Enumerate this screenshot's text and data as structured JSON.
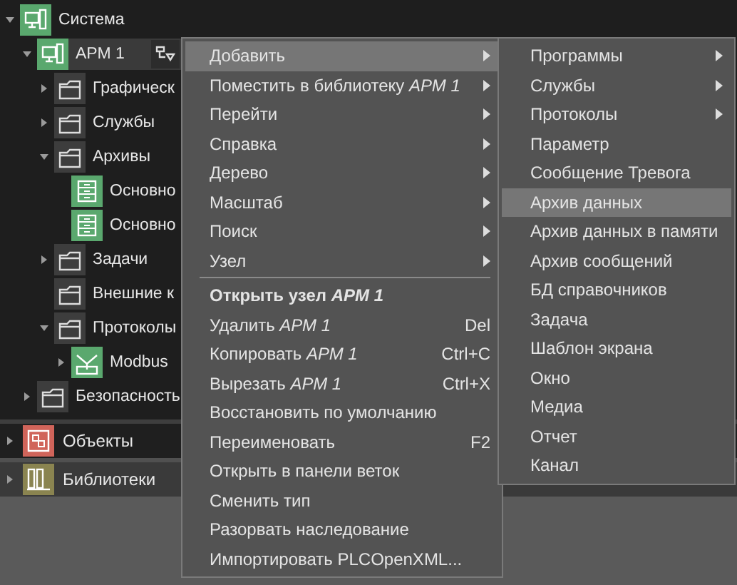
{
  "tree": [
    {
      "label": "Система",
      "kind": "system",
      "expanded": true,
      "has_children": true,
      "selected": false,
      "children": [
        {
          "label": "АРМ 1",
          "kind": "workstation",
          "expanded": true,
          "has_children": true,
          "selected": true,
          "filter_button": true,
          "children": [
            {
              "label": "Графическ",
              "kind": "folder",
              "expanded": false,
              "has_children": true,
              "selected": false
            },
            {
              "label": "Службы",
              "kind": "folder",
              "expanded": false,
              "has_children": true,
              "selected": false
            },
            {
              "label": "Архивы",
              "kind": "folder",
              "expanded": true,
              "has_children": true,
              "selected": false,
              "children": [
                {
                  "label": "Основно",
                  "kind": "archive",
                  "expanded": false,
                  "has_children": false,
                  "selected": false
                },
                {
                  "label": "Основно",
                  "kind": "archive",
                  "expanded": false,
                  "has_children": false,
                  "selected": false
                }
              ]
            },
            {
              "label": "Задачи",
              "kind": "folder",
              "expanded": false,
              "has_children": true,
              "selected": false
            },
            {
              "label": "Внешние к",
              "kind": "folder",
              "expanded": false,
              "has_children": false,
              "selected": false
            },
            {
              "label": "Протоколы",
              "kind": "folder",
              "expanded": true,
              "has_children": true,
              "selected": false,
              "children": [
                {
                  "label": "Modbus",
                  "kind": "modbus",
                  "expanded": false,
                  "has_children": true,
                  "selected": false
                }
              ]
            }
          ]
        },
        {
          "label": "Безопасность",
          "kind": "folder",
          "expanded": false,
          "has_children": true,
          "selected": false
        }
      ]
    }
  ],
  "sections": [
    {
      "label": "Объекты",
      "kind": "objects",
      "expanded": false
    },
    {
      "label": "Библиотеки",
      "kind": "libraries",
      "expanded": false
    }
  ],
  "context_menu": [
    {
      "kind": "item",
      "label": "Добавить",
      "submenu": true,
      "selected": true
    },
    {
      "kind": "item",
      "label": "Поместить в библиотеку *АРМ 1*",
      "submenu": true,
      "selected": false
    },
    {
      "kind": "item",
      "label": "Перейти",
      "submenu": true,
      "selected": false
    },
    {
      "kind": "item",
      "label": "Справка",
      "submenu": true,
      "selected": false
    },
    {
      "kind": "item",
      "label": "Дерево",
      "submenu": true,
      "selected": false
    },
    {
      "kind": "item",
      "label": "Масштаб",
      "submenu": true,
      "selected": false
    },
    {
      "kind": "item",
      "label": "Поиск",
      "submenu": true,
      "selected": false
    },
    {
      "kind": "item",
      "label": "Узел",
      "submenu": true,
      "selected": false
    },
    {
      "kind": "separator"
    },
    {
      "kind": "item",
      "label": "Открыть узел *АРМ 1*",
      "bold": true,
      "submenu": false,
      "selected": false
    },
    {
      "kind": "item",
      "label": "Удалить *АРМ 1*",
      "shortcut": "Del",
      "submenu": false,
      "selected": false
    },
    {
      "kind": "item",
      "label": "Копировать *АРМ 1*",
      "shortcut": "Ctrl+C",
      "submenu": false,
      "selected": false
    },
    {
      "kind": "item",
      "label": "Вырезать *АРМ 1*",
      "shortcut": "Ctrl+X",
      "submenu": false,
      "selected": false
    },
    {
      "kind": "item",
      "label": "Восстановить по умолчанию",
      "submenu": false,
      "selected": false
    },
    {
      "kind": "item",
      "label": "Переименовать",
      "shortcut": "F2",
      "submenu": false,
      "selected": false
    },
    {
      "kind": "item",
      "label": "Открыть в панели веток",
      "submenu": false,
      "selected": false
    },
    {
      "kind": "item",
      "label": "Сменить тип",
      "submenu": false,
      "selected": false
    },
    {
      "kind": "item",
      "label": "Разорвать наследование",
      "submenu": false,
      "selected": false
    },
    {
      "kind": "item",
      "label": "Импортировать PLCOpenXML...",
      "submenu": false,
      "selected": false
    }
  ],
  "add_submenu": [
    {
      "kind": "item",
      "label": "Программы",
      "submenu": true,
      "selected": false
    },
    {
      "kind": "item",
      "label": "Службы",
      "submenu": true,
      "selected": false
    },
    {
      "kind": "item",
      "label": "Протоколы",
      "submenu": true,
      "selected": false
    },
    {
      "kind": "item",
      "label": "Параметр",
      "submenu": false,
      "selected": false
    },
    {
      "kind": "item",
      "label": "Сообщение Тревога",
      "submenu": false,
      "selected": false
    },
    {
      "kind": "item",
      "label": "Архив данных",
      "submenu": false,
      "selected": true
    },
    {
      "kind": "item",
      "label": "Архив данных в памяти",
      "submenu": false,
      "selected": false
    },
    {
      "kind": "item",
      "label": "Архив сообщений",
      "submenu": false,
      "selected": false
    },
    {
      "kind": "item",
      "label": "БД справочников",
      "submenu": false,
      "selected": false
    },
    {
      "kind": "item",
      "label": "Задача",
      "submenu": false,
      "selected": false
    },
    {
      "kind": "item",
      "label": "Шаблон экрана",
      "submenu": false,
      "selected": false
    },
    {
      "kind": "item",
      "label": "Окно",
      "submenu": false,
      "selected": false
    },
    {
      "kind": "item",
      "label": "Медиа",
      "submenu": false,
      "selected": false
    },
    {
      "kind": "item",
      "label": "Отчет",
      "submenu": false,
      "selected": false
    },
    {
      "kind": "item",
      "label": "Канал",
      "submenu": false,
      "selected": false
    }
  ]
}
